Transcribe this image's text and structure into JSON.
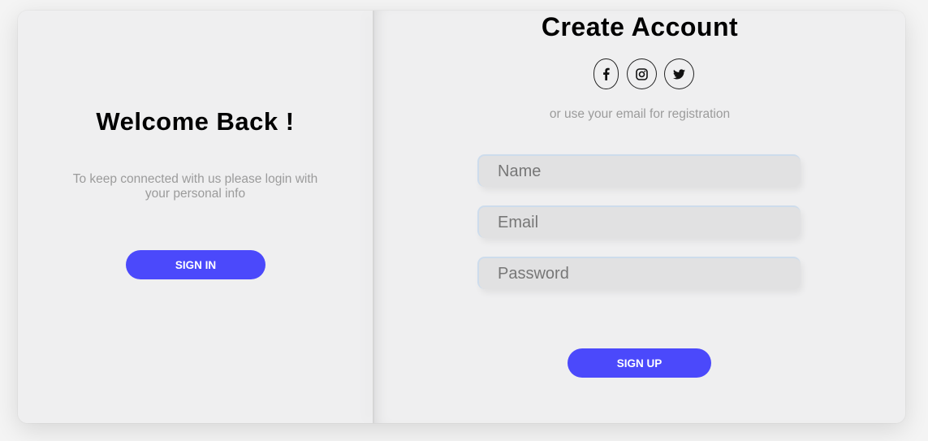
{
  "left": {
    "title": "Welcome Back !",
    "text": "To keep connected with us please login with your personal info",
    "signin_label": "SIGN IN"
  },
  "right": {
    "title": "Create Account",
    "social": [
      {
        "icon": "facebook-icon"
      },
      {
        "icon": "instagram-icon"
      },
      {
        "icon": "twitter-icon"
      }
    ],
    "registration_text": "or use your email for registration",
    "fields": {
      "name_placeholder": "Name",
      "email_placeholder": "Email",
      "password_placeholder": "Password"
    },
    "signup_label": "SIGN UP"
  },
  "colors": {
    "accent": "#4b49fb",
    "background": "#efeff0",
    "muted_text": "#9b9b9b",
    "field_bg": "#e1e1e2"
  }
}
